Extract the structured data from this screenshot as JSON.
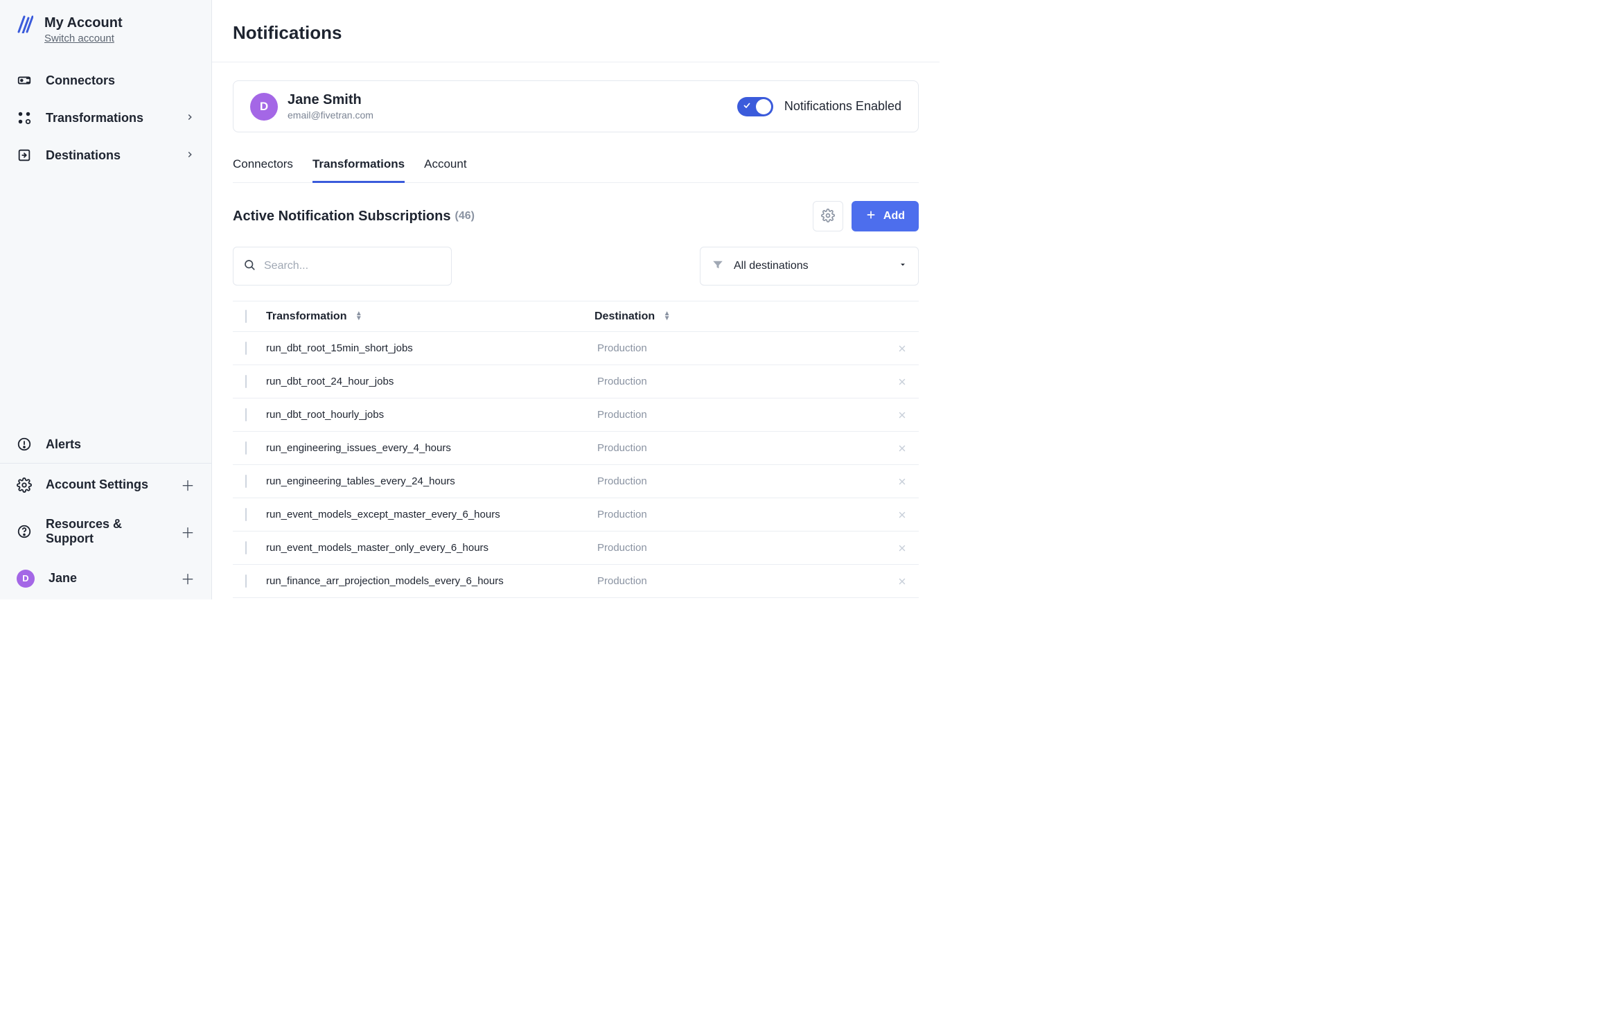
{
  "sidebar": {
    "account_title": "My Account",
    "switch_account": "Switch account",
    "nav": {
      "connectors": "Connectors",
      "transformations": "Transformations",
      "destinations": "Destinations"
    },
    "bottom": {
      "alerts": "Alerts",
      "account_settings": "Account Settings",
      "resources_support": "Resources & Support",
      "user_name": "Jane",
      "user_initial": "D"
    }
  },
  "page": {
    "title": "Notifications"
  },
  "user_card": {
    "avatar_initial": "D",
    "name": "Jane Smith",
    "email": "email@fivetran.com",
    "toggle_label": "Notifications Enabled",
    "toggle_on": true
  },
  "tabs": {
    "connectors": "Connectors",
    "transformations": "Transformations",
    "account": "Account",
    "active": "transformations"
  },
  "subs": {
    "title": "Active Notification Subscriptions",
    "count": "(46)",
    "add_label": "Add"
  },
  "filters": {
    "search_placeholder": "Search...",
    "destinations_label": "All destinations"
  },
  "table": {
    "col_transformation": "Transformation",
    "col_destination": "Destination",
    "rows": [
      {
        "name": "run_dbt_root_15min_short_jobs",
        "dest": "Production"
      },
      {
        "name": "run_dbt_root_24_hour_jobs",
        "dest": "Production"
      },
      {
        "name": "run_dbt_root_hourly_jobs",
        "dest": "Production"
      },
      {
        "name": "run_engineering_issues_every_4_hours",
        "dest": "Production"
      },
      {
        "name": "run_engineering_tables_every_24_hours",
        "dest": "Production"
      },
      {
        "name": "run_event_models_except_master_every_6_hours",
        "dest": "Production"
      },
      {
        "name": "run_event_models_master_only_every_6_hours",
        "dest": "Production"
      },
      {
        "name": "run_finance_arr_projection_models_every_6_hours",
        "dest": "Production"
      }
    ]
  }
}
